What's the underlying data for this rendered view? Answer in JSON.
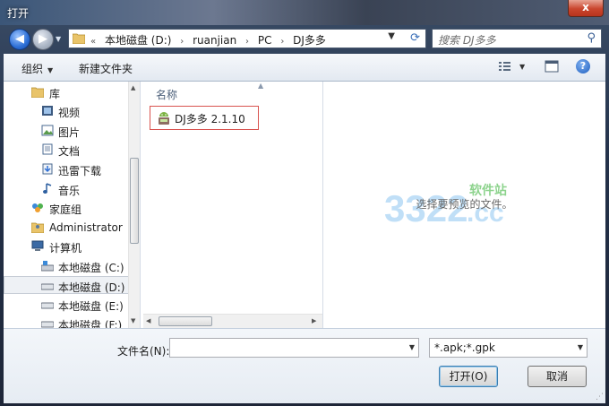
{
  "window": {
    "title": "打开",
    "close_glyph": "x"
  },
  "address": {
    "crumbs": [
      "本地磁盘 (D:)",
      "ruanjian",
      "PC",
      "DJ多多"
    ],
    "separator": "›"
  },
  "search": {
    "placeholder": "搜索 DJ多多"
  },
  "toolbar": {
    "organize_label": "组织",
    "new_folder_label": "新建文件夹"
  },
  "sidebar": {
    "items": [
      {
        "label": "库",
        "icon": "library-icon",
        "level": 1
      },
      {
        "label": "视频",
        "icon": "video-icon",
        "level": 2
      },
      {
        "label": "图片",
        "icon": "picture-icon",
        "level": 2
      },
      {
        "label": "文档",
        "icon": "document-icon",
        "level": 2
      },
      {
        "label": "迅雷下载",
        "icon": "download-icon",
        "level": 2
      },
      {
        "label": "音乐",
        "icon": "music-icon",
        "level": 2
      },
      {
        "label": "家庭组",
        "icon": "homegroup-icon",
        "level": 1
      },
      {
        "label": "Administrator",
        "icon": "user-folder-icon",
        "level": 1
      },
      {
        "label": "计算机",
        "icon": "computer-icon",
        "level": 1
      },
      {
        "label": "本地磁盘 (C:)",
        "icon": "system-drive-icon",
        "level": 2
      },
      {
        "label": "本地磁盘 (D:)",
        "icon": "drive-icon",
        "level": 2,
        "selected": true
      },
      {
        "label": "本地磁盘 (E:)",
        "icon": "drive-icon",
        "level": 2
      },
      {
        "label": "本地磁盘 (F:)",
        "icon": "drive-icon",
        "level": 2
      }
    ]
  },
  "filelist": {
    "column_name": "名称",
    "files": [
      {
        "name": "DJ多多 2.1.10",
        "icon": "apk-file-icon"
      }
    ]
  },
  "preview": {
    "message": "选择要预览的文件。",
    "watermark_number": "3322",
    "watermark_domain": ".cc",
    "watermark_site": "软件站"
  },
  "footer": {
    "filename_label": "文件名(N):",
    "filename_value": "",
    "filetype_value": "*.apk;*.gpk",
    "open_label": "打开(O)",
    "cancel_label": "取消"
  },
  "colors": {
    "accent": "#3a6fb8",
    "highlight_border": "#d9534f",
    "watermark_blue": "#4aa3e8",
    "watermark_green": "#5cc05c"
  }
}
